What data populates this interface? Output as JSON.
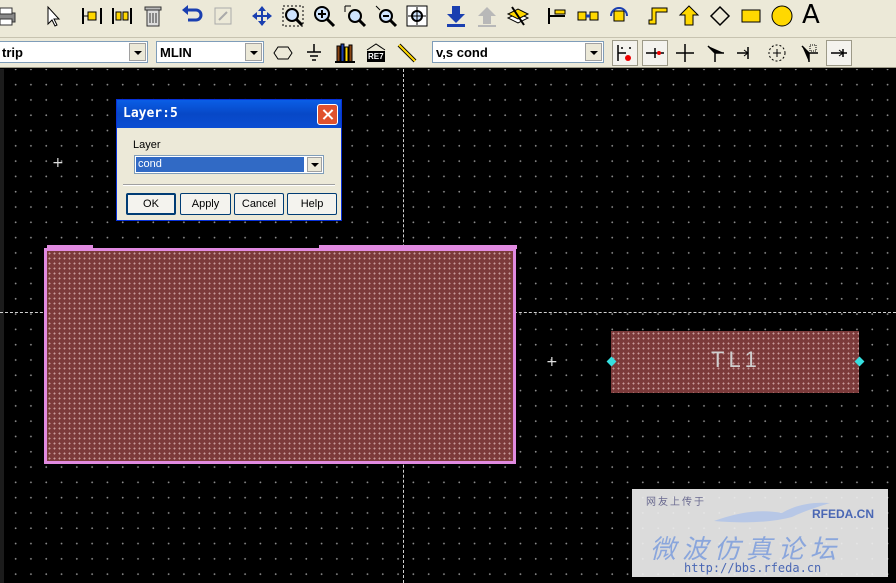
{
  "toolbar_row1": {
    "icons": [
      "print-icon",
      "select-arrow-icon",
      "align-left-icon",
      "align-center-icon",
      "delete-icon",
      "undo-icon",
      "redo-disabled-icon",
      "move-icon",
      "zoom-area-icon",
      "zoom-in-icon",
      "zoom-point-icon",
      "zoom-out-icon",
      "zoom-fit-icon",
      "push-down-icon",
      "pop-up-icon",
      "layers-icon",
      "port-add-icon",
      "snap-icon",
      "rotate-icon",
      "step-path-icon",
      "polygon-icon",
      "polyline-icon",
      "rectangle-icon",
      "circle-icon",
      "text-icon"
    ],
    "text_tool_label": "A"
  },
  "toolbar_row2": {
    "substrate_combo": "trip",
    "component_combo": "MLIN",
    "layer_combo": "v,s cond",
    "component_button_badge": "RE7"
  },
  "canvas": {
    "component_label": "TL1",
    "background": "#000000",
    "conductor_fill": "#7b3a3a",
    "outline_color": "#e08ae0",
    "port_color": "#36e0e0"
  },
  "dialog": {
    "title": "Layer:5",
    "field_label": "Layer",
    "selected_value": "cond",
    "buttons": {
      "ok": "OK",
      "apply": "Apply",
      "cancel": "Cancel",
      "help": "Help"
    }
  },
  "watermark": {
    "top_text": "网友上传于",
    "brand": "RFEDA.CN",
    "big_text": "微波仿真论坛",
    "url": "http://bbs.rfeda.cn"
  }
}
